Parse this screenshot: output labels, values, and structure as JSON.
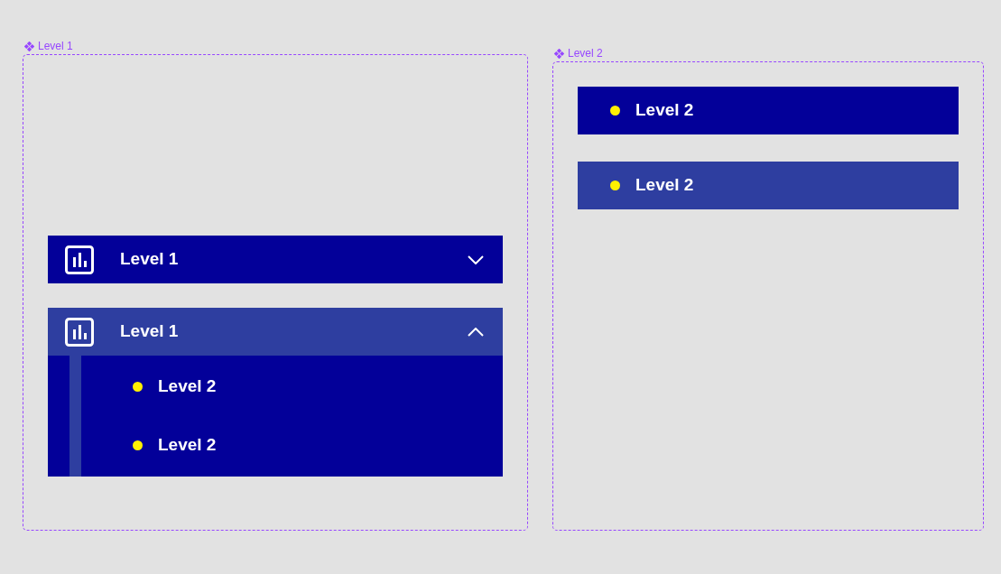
{
  "component_sets": [
    {
      "label": "Level 1",
      "kind": "level1",
      "items": [
        {
          "label": "Level 1",
          "expanded": false,
          "highlighted": false
        },
        {
          "label": "Level 1",
          "expanded": true,
          "highlighted": true,
          "children": [
            {
              "label": "Level 2"
            },
            {
              "label": "Level 2"
            }
          ]
        }
      ]
    },
    {
      "label": "Level 2",
      "kind": "level2",
      "items": [
        {
          "label": "Level 2",
          "highlighted": false
        },
        {
          "label": "Level 2",
          "highlighted": true
        }
      ]
    }
  ]
}
